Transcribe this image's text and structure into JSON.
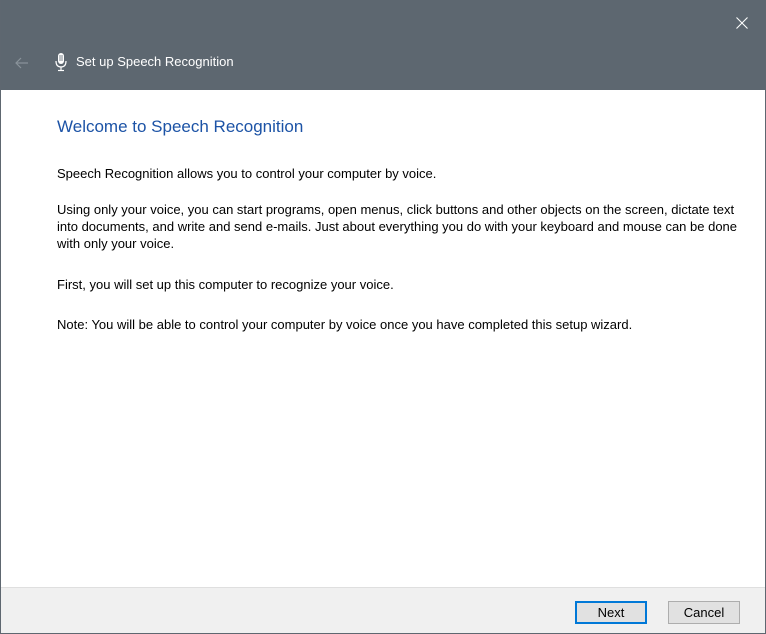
{
  "window": {
    "title": "Set up Speech Recognition",
    "close_icon": "close-icon",
    "back_icon": "back-arrow-icon",
    "app_icon": "microphone-icon"
  },
  "content": {
    "heading": "Welcome to Speech Recognition",
    "paragraphs": [
      "Speech Recognition allows you to control your computer by voice.",
      "Using only your voice, you can start programs, open menus, click buttons and other objects on the screen, dictate text into documents, and write and send e-mails. Just about everything you do with your keyboard and mouse can be done with only your voice.",
      "First, you will set up this computer to recognize your voice.",
      "Note: You will be able to control your computer by voice once you have completed this setup wizard."
    ]
  },
  "footer": {
    "next_label": "Next",
    "cancel_label": "Cancel"
  },
  "colors": {
    "titlebar": "#5d6770",
    "heading": "#1c53a6",
    "footer": "#f0f0f0",
    "focus_border": "#0078d7"
  }
}
